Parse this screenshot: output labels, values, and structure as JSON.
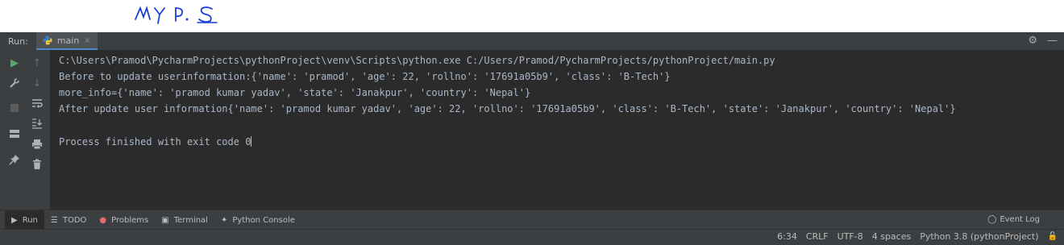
{
  "annotation": {
    "handwriting_text": "MY P.S"
  },
  "run_header": {
    "label": "Run:",
    "tab_label": "main",
    "close_glyph": "×",
    "settings_icon": "gear-icon",
    "minimize_icon": "minimize-icon",
    "settings_glyph": "⚙",
    "minimize_glyph": "—"
  },
  "toolbar_icons": [
    "rerun-icon",
    "up-arrow-icon",
    "wrench-icon",
    "down-arrow-icon",
    "stop-icon",
    "soft-wrap-icon",
    "layout-icon",
    "scroll-to-end-icon",
    "print-icon",
    "pin-icon",
    "trash-icon"
  ],
  "console": {
    "lines": [
      "C:\\Users\\Pramod\\PycharmProjects\\pythonProject\\venv\\Scripts\\python.exe C:/Users/Pramod/PycharmProjects/pythonProject/main.py",
      "Before to update userinformation:{'name': 'pramod', 'age': 22, 'rollno': '17691a05b9', 'class': 'B-Tech'}",
      "more_info={'name': 'pramod kumar yadav', 'state': 'Janakpur', 'country': 'Nepal'}",
      "After update user information{'name': 'pramod kumar yadav', 'age': 22, 'rollno': '17691a05b9', 'class': 'B-Tech', 'state': 'Janakpur', 'country': 'Nepal'}",
      "",
      "Process finished with exit code 0"
    ]
  },
  "bottom_tabs": [
    {
      "label": "Run",
      "icon": "run-icon",
      "glyph": "▶"
    },
    {
      "label": "TODO",
      "icon": "todo-icon",
      "glyph": "☰"
    },
    {
      "label": "Problems",
      "icon": "problems-icon",
      "glyph": "●"
    },
    {
      "label": "Terminal",
      "icon": "terminal-icon",
      "glyph": "▣"
    },
    {
      "label": "Python Console",
      "icon": "python-console-icon",
      "glyph": "✦"
    }
  ],
  "event_log": {
    "label": "Event Log",
    "icon": "event-log-icon",
    "glyph": "◯"
  },
  "status": {
    "position": "6:34",
    "line_separator": "CRLF",
    "encoding": "UTF-8",
    "indent": "4 spaces",
    "interpreter": "Python 3.8 (pythonProject)",
    "lock_icon": "lock-icon",
    "lock_glyph": "🔓"
  },
  "colors": {
    "panel_bg": "#3c3f41",
    "console_bg": "#2b2b2b",
    "console_text": "#a9b7c6",
    "run_green": "#59a869",
    "annotation_blue": "#1a3fd9"
  }
}
